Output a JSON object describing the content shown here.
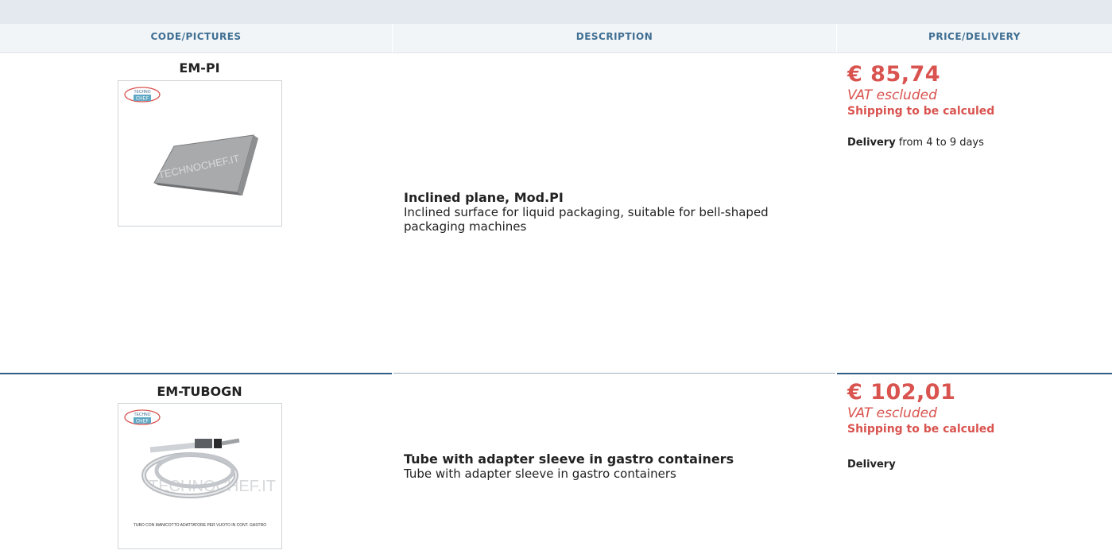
{
  "header": {
    "col1": "CODE/PICTURES",
    "col2": "DESCRIPTION",
    "col3": "PRICE/DELIVERY"
  },
  "products": [
    {
      "code": "EM-PI",
      "logo_text": "TECHNO CHEF",
      "watermark": "TECHNOCHEF.IT",
      "image_caption": "",
      "title": "Inclined plane, Mod.PI",
      "description": "Inclined surface for liquid packaging, suitable for bell-shaped packaging machines",
      "price": "€ 85,74",
      "vat": "VAT escluded",
      "shipping": "Shipping to be calculed",
      "delivery_label": "Delivery",
      "delivery_text": "from 4 to 9 days"
    },
    {
      "code": "EM-TUBOGN",
      "logo_text": "TECHNO CHEF",
      "watermark": "TECHNOCHEF.IT",
      "image_caption": "TUBO CON MANICOTTO ADATTATORE PER VUOTO IN CONT. GASTRO",
      "title": "Tube with adapter sleeve in gastro containers",
      "description": "Tube with adapter sleeve in gastro containers",
      "price": "€ 102,01",
      "vat": "VAT escluded",
      "shipping": "Shipping to be calculed",
      "delivery_label": "Delivery",
      "delivery_text": ""
    }
  ],
  "colors": {
    "header_text": "#3f6f93",
    "price": "#d9534f",
    "divider": "#2f5d86"
  }
}
